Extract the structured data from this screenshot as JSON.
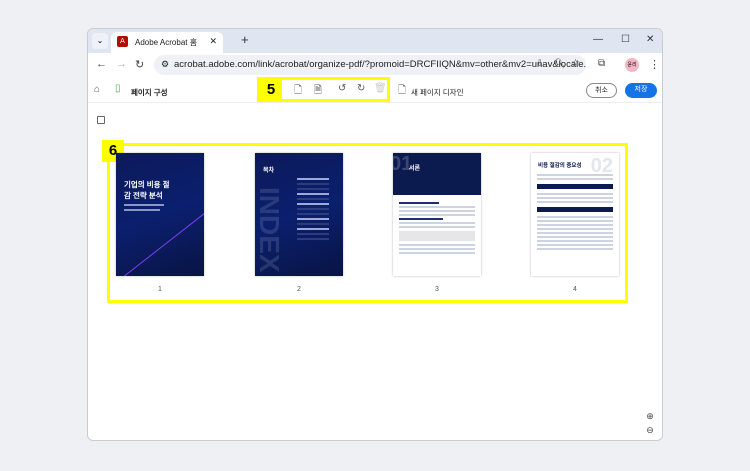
{
  "browser": {
    "tab_title": "Adobe Acrobat 홈",
    "url": "acrobat.adobe.com/link/acrobat/organize-pdf/?promoid=DRCFIIQN&mv=other&mv2=unav&locale...",
    "avatar": "윤리"
  },
  "app": {
    "title": "페이지 구성",
    "new_design": "새 페이지 디자인",
    "cancel": "취소",
    "save": "저장",
    "accent": "#1473e6"
  },
  "annotations": {
    "toolbar": "5",
    "pages": "6"
  },
  "pages": [
    {
      "number": "1",
      "title": "기업의 비용 절감 전략 분석"
    },
    {
      "number": "2",
      "title": "목차",
      "watermark": "INDEX"
    },
    {
      "number": "3",
      "title": "서론",
      "big": "01"
    },
    {
      "number": "4",
      "title": "비용 절감의 중요성",
      "big": "02"
    }
  ]
}
